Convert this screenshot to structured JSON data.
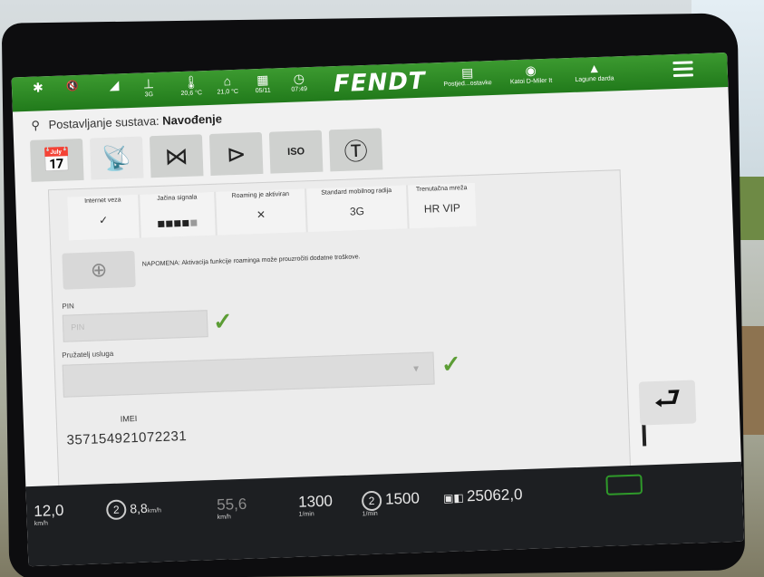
{
  "topbar": {
    "items": [
      {
        "icon": "bluetooth-icon",
        "glyph": "✱",
        "value": ""
      },
      {
        "icon": "mute-icon",
        "glyph": "🔇",
        "value": ""
      },
      {
        "icon": "signal-icon",
        "glyph": "◢",
        "value": ""
      },
      {
        "icon": "network-3g-icon",
        "glyph": "⊥",
        "value": "3G"
      },
      {
        "icon": "outside-temp-icon",
        "glyph": "🌡",
        "value": "20,6 °C"
      },
      {
        "icon": "cabin-temp-icon",
        "glyph": "⌂",
        "value": "21,0 °C"
      },
      {
        "icon": "date-icon",
        "glyph": "▦",
        "value": "05/11"
      },
      {
        "icon": "clock-icon",
        "glyph": "◷",
        "value": "07:49"
      },
      {
        "icon": "settings-short-icon",
        "glyph": "▤",
        "value": "Postjed...ostavke"
      },
      {
        "icon": "driver-icon",
        "glyph": "◉",
        "value": "Katoi D-Miler It"
      },
      {
        "icon": "terrain-icon",
        "glyph": "▲",
        "value": "Lagune darda"
      }
    ],
    "brand": "FENDT"
  },
  "title": {
    "prefix": "Postavljanje sustava:",
    "section": "Navođenje"
  },
  "tabs": [
    {
      "icon": "calendar-icon",
      "glyph": "📅"
    },
    {
      "icon": "satellite-icon",
      "glyph": "📡"
    },
    {
      "icon": "network-icon",
      "glyph": "⋈"
    },
    {
      "icon": "steering-icon",
      "glyph": "⊳"
    },
    {
      "icon": "isobus-icon",
      "glyph": "ISO"
    },
    {
      "icon": "tim-icon",
      "glyph": "Ⓣ"
    }
  ],
  "status": {
    "headers": [
      "Internet veza",
      "Jačina signala",
      "Roaming je aktiviran",
      "Standard mobilnog radija",
      "Trenutačna mreža"
    ],
    "radio_standard": "3G",
    "network": "HR VIP",
    "signal_level": 4,
    "signal_max": 5
  },
  "note": "NAPOMENA: Aktivacija funkcije roaminga može prouzročiti dodatne troškove.",
  "pin": {
    "label": "PIN",
    "placeholder": "PIN"
  },
  "provider": {
    "label": "Pružatelj usluga"
  },
  "imei": {
    "label": "IMEI",
    "value": "357154921072231"
  },
  "bottombar": {
    "speed": {
      "value": "12,0",
      "unit": "km/h"
    },
    "speed2": {
      "value": "8,8",
      "unit": "km/h",
      "index": "2"
    },
    "speed3": {
      "value": "55,6",
      "unit": "km/h"
    },
    "rpm1": {
      "value": "1300",
      "unit": "1/min"
    },
    "rpm2": {
      "value": "1500",
      "unit": "1/min",
      "index": "2"
    },
    "hours": {
      "value": "25062,0"
    }
  }
}
